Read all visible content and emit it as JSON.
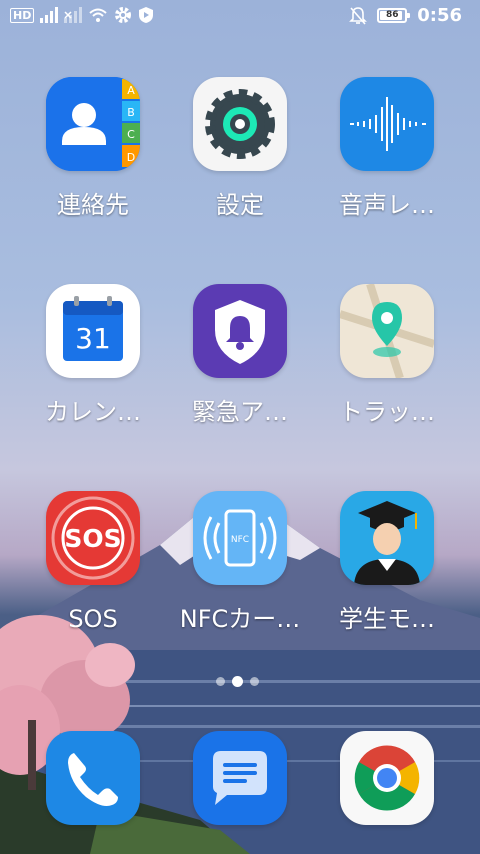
{
  "status_bar": {
    "left_icons": [
      "hd-badge",
      "signal-icon",
      "signal-no-sim-icon",
      "wifi-icon",
      "settings-gear-icon",
      "shield-icon"
    ],
    "hd_label": "HD",
    "right_icons": [
      "notifications-off-icon",
      "battery-icon"
    ],
    "battery_level": "86",
    "time": "0:56"
  },
  "apps": [
    {
      "label": "連絡先",
      "icon": "contacts-icon"
    },
    {
      "label": "設定",
      "icon": "settings-icon"
    },
    {
      "label": "音声レ…",
      "icon": "voice-recorder-icon"
    },
    {
      "label": "カレン…",
      "icon": "calendar-icon",
      "icon_text": "31"
    },
    {
      "label": "緊急ア…",
      "icon": "emergency-alert-icon"
    },
    {
      "label": "トラッ…",
      "icon": "tracker-map-icon"
    },
    {
      "label": "SOS",
      "icon": "sos-icon",
      "icon_text": "SOS"
    },
    {
      "label": "NFCカー…",
      "icon": "nfc-card-icon",
      "icon_text": "NFC"
    },
    {
      "label": "学生モ…",
      "icon": "student-mode-icon"
    }
  ],
  "contacts_tabs": [
    "A",
    "B",
    "C",
    "D"
  ],
  "page_indicator": {
    "pages": 3,
    "current_index": 1
  },
  "dock": [
    {
      "icon": "phone-icon"
    },
    {
      "icon": "messages-icon"
    },
    {
      "icon": "chrome-icon"
    }
  ]
}
